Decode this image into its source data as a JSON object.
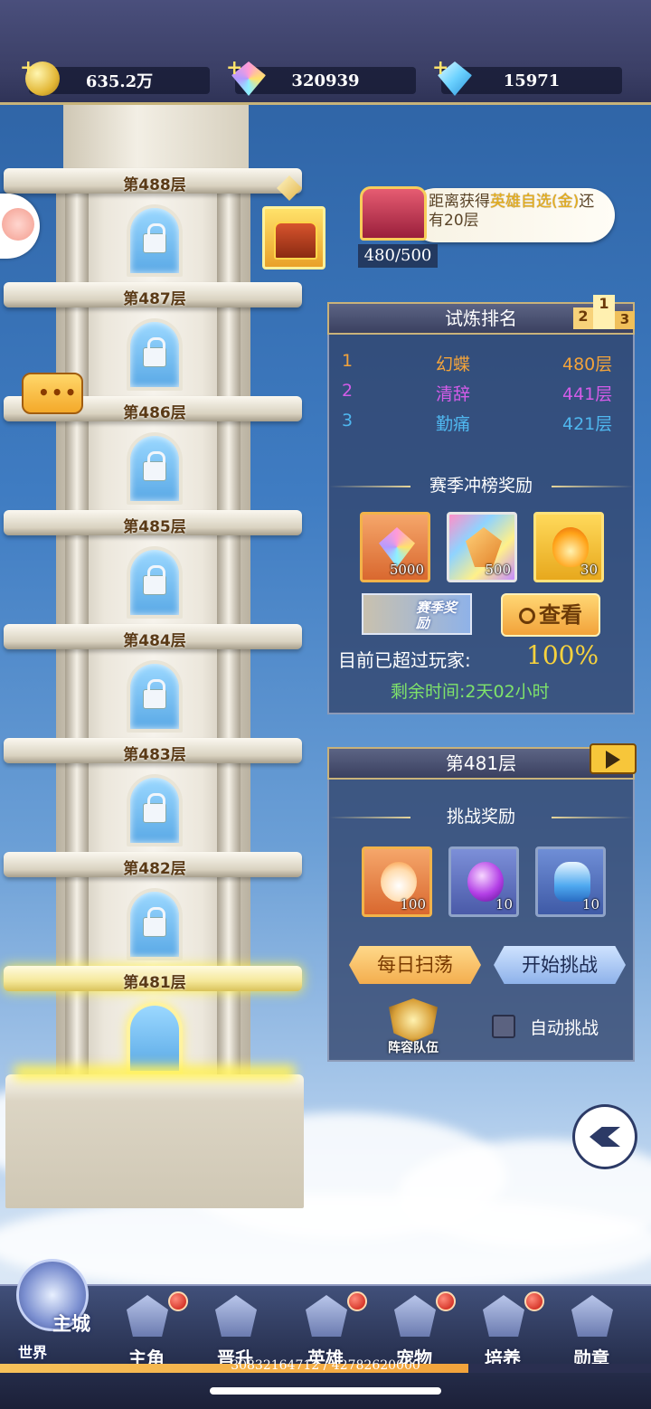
{
  "resources": {
    "gold": "635.2万",
    "crystal_gems": "320939",
    "diamonds": "15971"
  },
  "tower": {
    "floors": [
      "第488层",
      "第487层",
      "第486层",
      "第485层",
      "第484层",
      "第483层",
      "第482层",
      "第481层"
    ],
    "current_floor": "第481层"
  },
  "hero_reward": {
    "text_prefix": "距离获得",
    "highlight": "英雄自选(金)",
    "text_suffix": "还有20层",
    "progress": "480/500"
  },
  "ranking": {
    "title": "试炼排名",
    "rows": [
      {
        "rank": "1",
        "name": "幻蝶",
        "floor": "480层",
        "color": "#f2a33b"
      },
      {
        "rank": "2",
        "name": "清辞",
        "floor": "441层",
        "color": "#d35ce8"
      },
      {
        "rank": "3",
        "name": "勤痛",
        "floor": "421层",
        "color": "#4fb7ef"
      }
    ],
    "season_title": "赛季冲榜奖励",
    "season_rewards": [
      {
        "icon": "rainbow-gem-icon",
        "count": "5000"
      },
      {
        "icon": "amber-crystal-icon",
        "count": "500"
      },
      {
        "icon": "flame-spirit-icon",
        "count": "30"
      }
    ],
    "season_badge": "赛季奖励",
    "view_button": "查看",
    "surpass_label": "目前已超过玩家:",
    "surpass_value": "100%",
    "remaining": "剩余时间:2天02小时"
  },
  "challenge": {
    "title": "第481层",
    "reward_title": "挑战奖励",
    "rewards": [
      {
        "icon": "fire-skull-icon",
        "count": "100"
      },
      {
        "icon": "purple-orb-icon",
        "count": "10"
      },
      {
        "icon": "potion-bottle-icon",
        "count": "10"
      }
    ],
    "sweep_button": "每日扫荡",
    "start_button": "开始挑战",
    "lineup_label": "阵容队伍",
    "auto_label": "自动挑战"
  },
  "nav": {
    "items": [
      {
        "label": "主角",
        "icon": "hero-helmet-icon",
        "dot": true
      },
      {
        "label": "晋升",
        "icon": "wings-icon",
        "dot": false
      },
      {
        "label": "英雄",
        "icon": "knight-helmet-icon",
        "dot": true
      },
      {
        "label": "宠物",
        "icon": "pet-icon",
        "dot": true
      },
      {
        "label": "培养",
        "icon": "star-emblem-icon",
        "dot": true
      },
      {
        "label": "勋章",
        "icon": "medal-icon",
        "dot": false
      }
    ],
    "main_city": "主城",
    "world": "世界"
  },
  "exp": {
    "text": "30832164712 / 42782620000",
    "fill": 0.72
  }
}
